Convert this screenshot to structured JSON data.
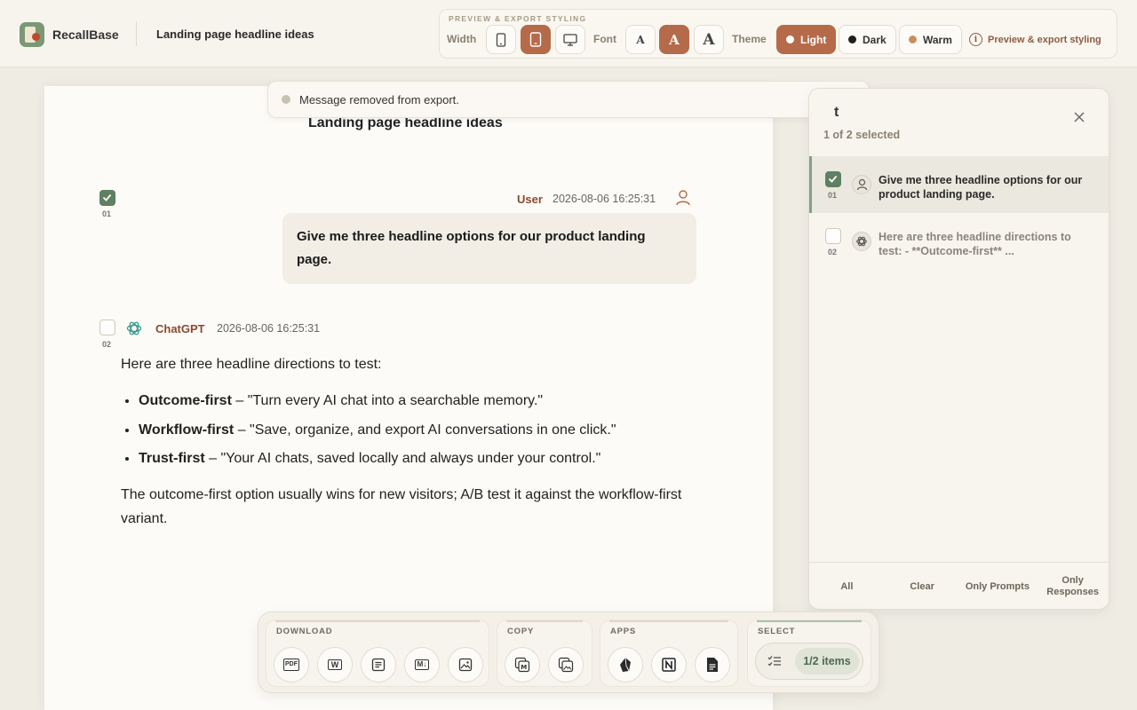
{
  "app": {
    "name": "RecallBase",
    "doc_title": "Landing page headline ideas"
  },
  "styling": {
    "caption": "PREVIEW & EXPORT STYLING",
    "width_label": "Width",
    "font_label": "Font",
    "theme_label": "Theme",
    "font_glyph": "A",
    "themes": [
      {
        "label": "Light",
        "color": "#ffffff"
      },
      {
        "label": "Dark",
        "color": "#1f1f1f"
      },
      {
        "label": "Warm",
        "color": "#c9905f"
      }
    ],
    "preview_link": "Preview & export styling",
    "info_glyph": "i"
  },
  "toast": {
    "text": "Message removed from export."
  },
  "document": {
    "heading": "Landing page headline ideas",
    "messages": [
      {
        "num": "01",
        "author": "User",
        "timestamp": "2026-08-06 16:25:31",
        "text": "Give me three headline options for our product landing page."
      },
      {
        "num": "02",
        "author": "ChatGPT",
        "timestamp": "2026-08-06 16:25:31",
        "intro": "Here are three headline directions to test:",
        "bullets": [
          {
            "bold": "Outcome-first",
            "rest": " – \"Turn every AI chat into a searchable memory.\""
          },
          {
            "bold": "Workflow-first",
            "rest": " – \"Save, organize, and export AI conversations in one click.\""
          },
          {
            "bold": "Trust-first",
            "rest": " – \"Your AI chats, saved locally and always under your control.\""
          }
        ],
        "outro": "The outcome-first option usually wins for new visitors; A/B test it against the workflow-first variant."
      }
    ]
  },
  "select_panel": {
    "title": "t",
    "count": "1 of 2 selected",
    "items": [
      {
        "num": "01",
        "text": "Give me three headline options for our product landing page.",
        "selected": true
      },
      {
        "num": "02",
        "text": "Here are three headline directions to test: - **Outcome-first** ...",
        "selected": false
      }
    ],
    "footer": [
      "All",
      "Clear",
      "Only Prompts",
      "Only Responses"
    ]
  },
  "toolbar": {
    "download_label": "DOWNLOAD",
    "copy_label": "COPY",
    "apps_label": "APPS",
    "select_label": "SELECT",
    "items_count": "1/2 items",
    "pdf": "PDF",
    "word": "W",
    "md": "M↓",
    "md_short": "M"
  },
  "colors": {
    "accent": "#b56a49",
    "green": "#5f8063",
    "author": "#8a4a2f"
  }
}
